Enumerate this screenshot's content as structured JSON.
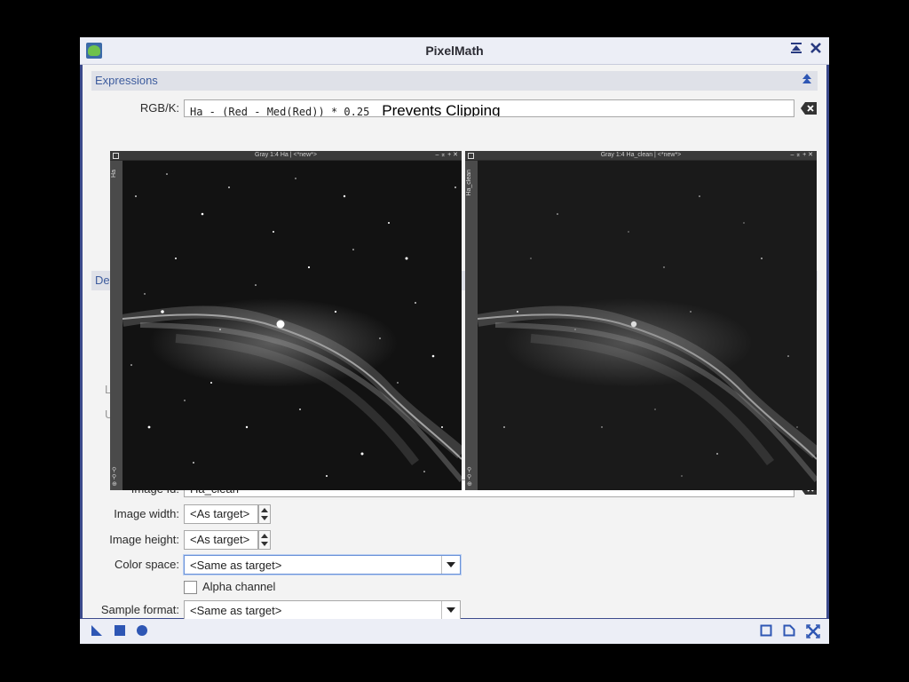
{
  "window": {
    "title": "PixelMath",
    "controls": {
      "shade_label": "⯊",
      "close_label": "✕"
    }
  },
  "expressions": {
    "header": "Expressions",
    "rgbk_label": "RGB/K:",
    "rgbk_value": "Ha - (Red - Med(Red)) * 0.25",
    "annotation": "Prevents Clipping"
  },
  "destination": {
    "header_partial": "De",
    "image_id_label": "Image Id:",
    "image_id_value": "Ha_clean",
    "image_width_label": "Image width:",
    "image_width_value": "<As target>",
    "image_height_label": "Image height:",
    "image_height_value": "<As target>",
    "color_space_label": "Color space:",
    "color_space_value": "<Same as target>",
    "alpha_channel_label": "Alpha channel",
    "alpha_channel_checked": false,
    "sample_format_label": "Sample format:",
    "sample_format_value": "<Same as target>",
    "hidden_labels": [
      "L",
      "U"
    ]
  },
  "image_windows": [
    {
      "title": "Gray 1:4 Ha | <*new*>",
      "side_label": "Ha",
      "controls": "– ⌅ + ✕"
    },
    {
      "title": "Gray 1:4 Ha_clean | <*new*>",
      "side_label": "Ha_clean",
      "controls": "– ⌅ + ✕"
    }
  ],
  "bottom_bar": {
    "left_icons": [
      "new-instance-icon",
      "apply-icon",
      "apply-global-icon"
    ],
    "right_icons": [
      "browse-documentation-icon",
      "edit-instance-icon",
      "reset-icon"
    ]
  },
  "colors": {
    "accent": "#3c4a8c",
    "section_text": "#3d5c9e",
    "icon_blue": "#2e56b4"
  }
}
